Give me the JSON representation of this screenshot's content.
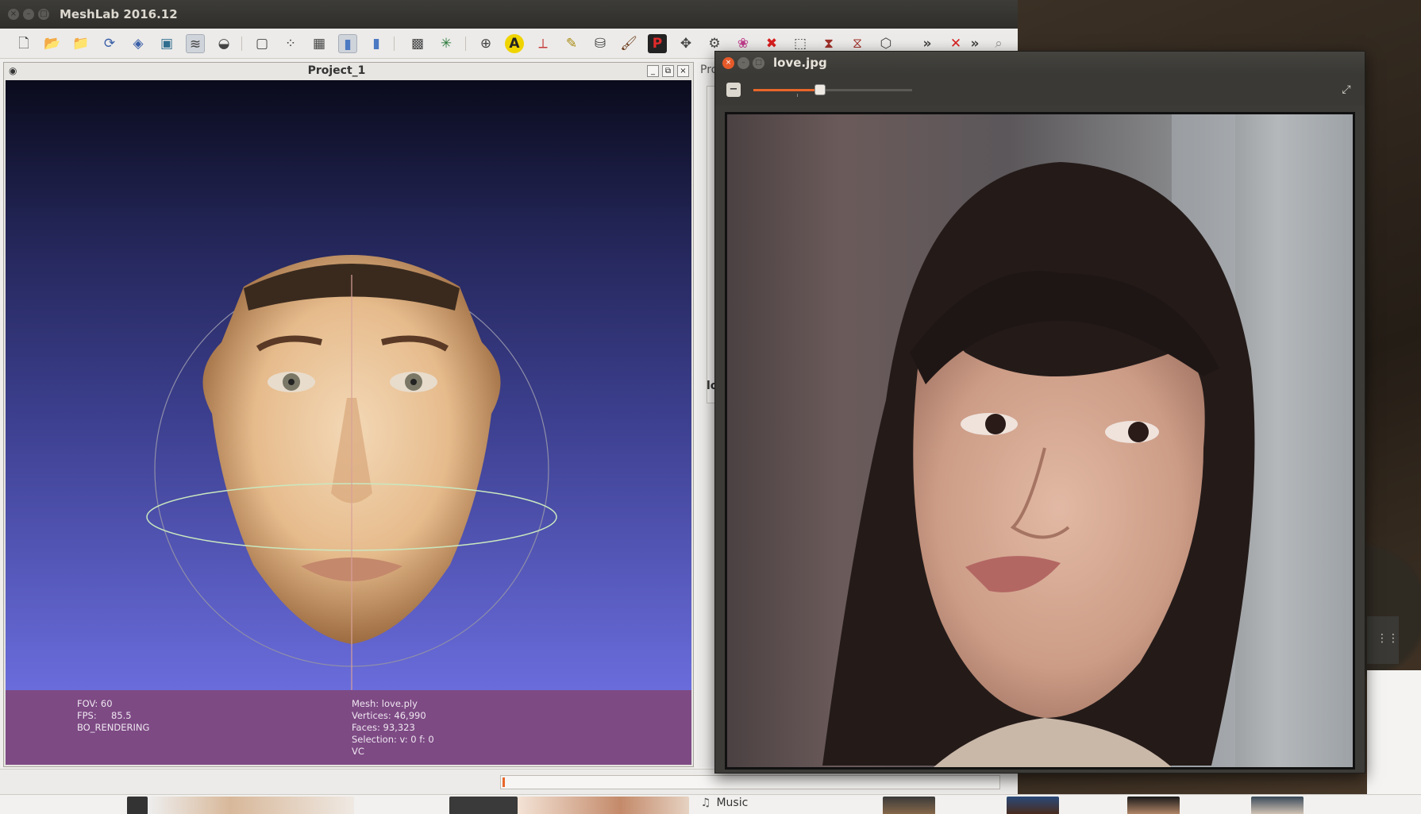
{
  "meshlab": {
    "title": "MeshLab 2016.12",
    "window_buttons": [
      "×",
      "–",
      "□"
    ]
  },
  "toolbar": {
    "icons": [
      "new-document-icon",
      "open-folder-icon",
      "open-project-icon",
      "reload-icon",
      "save-icon",
      "snapshot-icon",
      "layers-icon",
      "render-mode-icon",
      "bounding-box-icon",
      "points-icon",
      "wireframe-icon",
      "flat-icon",
      "smooth-icon",
      "texture-icon",
      "axis-icon",
      "trackball-icon",
      "annotation-icon",
      "measure-icon",
      "paint-icon",
      "brush-icon",
      "pick-points-icon",
      "align-icon",
      "select-faces-icon",
      "select-vertices-icon",
      "color-icon",
      "remove-icon",
      "select-rect-icon",
      "select-connected-icon",
      "select-all-icon",
      "select-none-icon",
      "more-icon",
      "delete-icon",
      "more-icon-2",
      "search-icon"
    ],
    "glyph_A": "A",
    "glyph_P": "P",
    "overflow": "»"
  },
  "project": {
    "title": "Project_1",
    "buttons": [
      "_",
      "⧉",
      "×"
    ]
  },
  "viewport_info": {
    "fov": "FOV: 60",
    "fps": "FPS:     85.5",
    "mode": "BO_RENDERING",
    "mesh": "Mesh: love.ply",
    "vertices": "Vertices: 46,990",
    "faces": "Faces: 93,323",
    "selection": "Selection: v: 0 f: 0",
    "vc": "VC"
  },
  "layer_panel": {
    "header": "Pro",
    "lo": "lo"
  },
  "viewer": {
    "title": "love.jpg",
    "zoom_out": "−",
    "zoom_level": 0.42,
    "fullscreen": "⤢"
  },
  "taskbar": {
    "music_label": "Music"
  },
  "colors": {
    "accent": "#e8662a",
    "viewport_top": "#0a0b1c",
    "viewport_bottom": "#6a6cdc",
    "info_panel": "#7d4a84"
  }
}
